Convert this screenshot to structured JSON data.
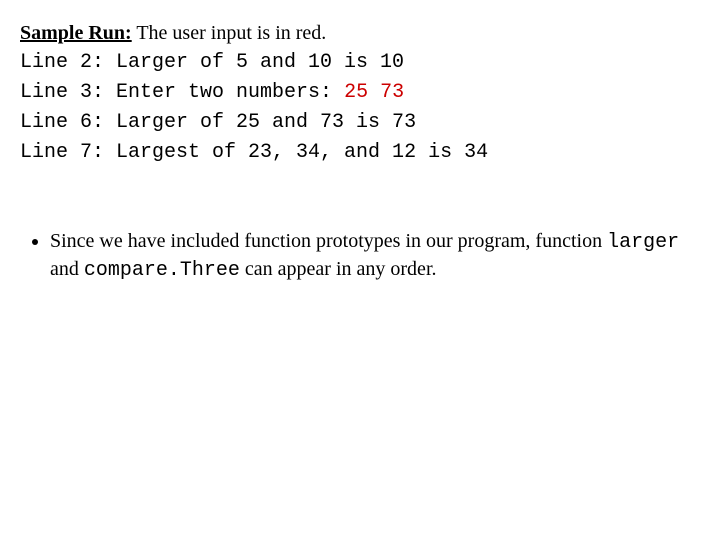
{
  "header": {
    "label": "Sample Run:",
    "note": " The user input is in red."
  },
  "lines": {
    "l2_prefix": "Line 2: Larger of 5 and 10 is 10",
    "l3_prefix": "Line 3: Enter two numbers: ",
    "l3_input": "25 73",
    "l6_prefix": "Line 6: Larger of 25 and 73 is 73",
    "l7_prefix": "Line 7: Largest of 23, 34, and 12 is 34"
  },
  "bullet": {
    "part1": "Since we have included function prototypes in our program, function ",
    "code1": "larger",
    "part2": " and ",
    "code2": "compare.Three",
    "part3": " can appear in any order."
  }
}
